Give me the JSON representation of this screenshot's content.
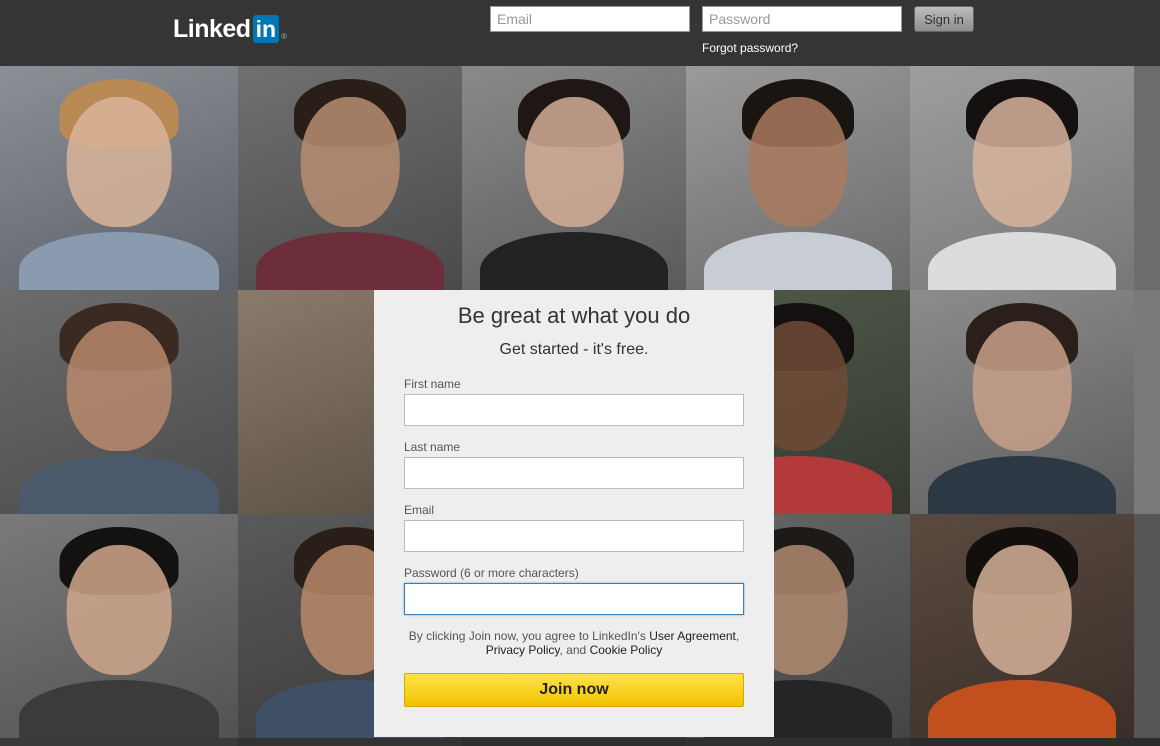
{
  "header": {
    "logo_text": "Linked",
    "logo_in": "in",
    "logo_reg": "®",
    "email_placeholder": "Email",
    "password_placeholder": "Password",
    "signin_label": "Sign in",
    "forgot_label": "Forgot password?"
  },
  "signup": {
    "title": "Be great at what you do",
    "subtitle": "Get started - it's free.",
    "first_name_label": "First name",
    "last_name_label": "Last name",
    "email_label": "Email",
    "password_label": "Password (6 or more characters)",
    "legal_prefix": "By clicking Join now, you agree to LinkedIn's",
    "user_agreement": "User Agreement",
    "comma": ",",
    "privacy_policy": "Privacy Policy",
    "and_text": ", and",
    "cookie_policy": "Cookie Policy",
    "join_label": "Join now"
  },
  "colors": {
    "header_bg": "#353535",
    "brand_blue": "#0077b5",
    "join_yellow": "#f3c300",
    "card_bg": "#eeeeee"
  }
}
